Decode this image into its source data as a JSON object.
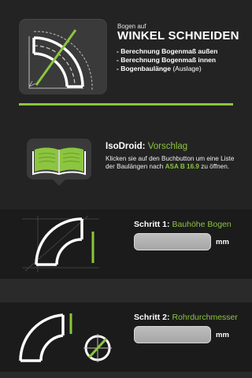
{
  "header": {
    "small_label": "Bogen auf",
    "title": "WINKEL SCHNEIDEN",
    "features": [
      {
        "text": "- Berechnung Bogenmaß außen",
        "note": ""
      },
      {
        "text": "- Berechnung Bogenmaß innen",
        "note": ""
      },
      {
        "text": "- Bogenbaulänge",
        "note": "(Auslage)"
      }
    ],
    "icon": "pipe-bend-angle-cut-icon"
  },
  "suggestion": {
    "brand": "IsoDroid:",
    "title_accent": "Vorschlag",
    "text_before": "Klicken sie auf den Buchbutton um eine Liste der Baulängen nach",
    "text_accent": "ASA B 16.9",
    "text_after": "zu öffnen.",
    "icon": "open-book-icon"
  },
  "step1": {
    "label": "Schritt 1:",
    "label_accent": "Bauhöhe Bogen",
    "value": "",
    "unit": "mm",
    "icon": "elbow-height-icon"
  },
  "step2": {
    "label": "Schritt 2:",
    "label_accent": "Rohrdurchmesser",
    "value": "",
    "unit": "mm",
    "icon": "pipe-diameter-icon"
  },
  "colors": {
    "accent": "#8cc53f",
    "background": "#232323",
    "band": "#1b1b1b",
    "tile": "#3a3a3a"
  }
}
